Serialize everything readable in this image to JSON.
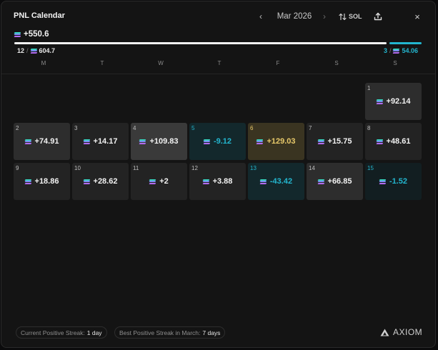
{
  "header": {
    "title": "PNL Calendar",
    "prev_icon": "‹",
    "month": "Mar 2026",
    "next_icon": "›",
    "currency_toggle": "SOL",
    "close_icon": "×"
  },
  "summary": {
    "total_pnl": "+550.6",
    "positive_days": "12",
    "positive_amount": "604.7",
    "negative_days": "3",
    "negative_amount": "54.06",
    "positive_ratio": 0.918
  },
  "weekdays": [
    "M",
    "T",
    "W",
    "T",
    "F",
    "S",
    "S"
  ],
  "days": [
    {
      "day": "1",
      "value": "+92.14",
      "tone": "pos"
    },
    {
      "day": "2",
      "value": "+74.91",
      "tone": "pos"
    },
    {
      "day": "3",
      "value": "+14.17",
      "tone": "pos-weak"
    },
    {
      "day": "4",
      "value": "+109.83",
      "tone": "pos-strong"
    },
    {
      "day": "5",
      "value": "-9.12",
      "tone": "neg"
    },
    {
      "day": "6",
      "value": "+129.03",
      "tone": "gold"
    },
    {
      "day": "7",
      "value": "+15.75",
      "tone": "pos-weak"
    },
    {
      "day": "8",
      "value": "+48.61",
      "tone": "pos-weak"
    },
    {
      "day": "9",
      "value": "+18.86",
      "tone": "pos-weak"
    },
    {
      "day": "10",
      "value": "+28.62",
      "tone": "pos-weak"
    },
    {
      "day": "11",
      "value": "+2",
      "tone": "pos-weak"
    },
    {
      "day": "12",
      "value": "+3.88",
      "tone": "pos-weak"
    },
    {
      "day": "13",
      "value": "-43.42",
      "tone": "neg"
    },
    {
      "day": "14",
      "value": "+66.85",
      "tone": "pos"
    },
    {
      "day": "15",
      "value": "-1.52",
      "tone": "neg-weak"
    }
  ],
  "footer": {
    "current_streak_label": "Current Positive Streak:",
    "current_streak_value": "1 day",
    "best_streak_label": "Best Positive Streak in March:",
    "best_streak_value": "7 days",
    "brand": "AXIOM"
  },
  "colors": {
    "positive_bar": "#f2f2f2",
    "negative_accent": "#23b6cf",
    "best_day": "#e8c96a"
  }
}
